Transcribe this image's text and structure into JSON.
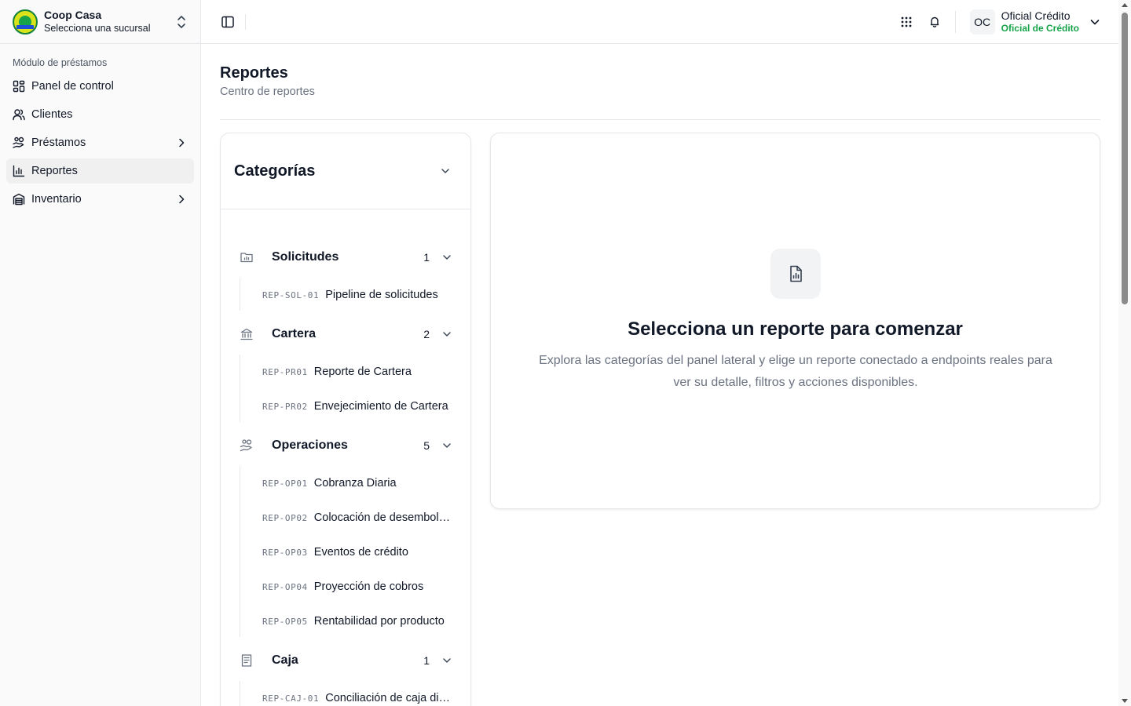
{
  "brand": {
    "name": "Coop Casa",
    "subtitle": "Selecciona una sucursal"
  },
  "sidebar": {
    "group_label": "Módulo de préstamos",
    "items": [
      {
        "label": "Panel de control",
        "icon": "dashboard-icon"
      },
      {
        "label": "Clientes",
        "icon": "users-icon"
      },
      {
        "label": "Préstamos",
        "icon": "hand-coins-icon",
        "has_submenu": true
      },
      {
        "label": "Reportes",
        "icon": "bar-chart-icon",
        "active": true
      },
      {
        "label": "Inventario",
        "icon": "warehouse-icon",
        "has_submenu": true
      }
    ]
  },
  "header": {
    "user": {
      "initials": "OC",
      "name": "Oficial Crédito",
      "role": "Oficial de Crédito"
    }
  },
  "page": {
    "title": "Reportes",
    "subtitle": "Centro de reportes"
  },
  "categories": {
    "title": "Categorías",
    "groups": [
      {
        "name": "Solicitudes",
        "count": "1",
        "icon": "folder-chart-icon",
        "reports": [
          {
            "code": "REP-SOL-01",
            "name": "Pipeline de solicitudes"
          }
        ]
      },
      {
        "name": "Cartera",
        "count": "2",
        "icon": "landmark-icon",
        "reports": [
          {
            "code": "REP-PR01",
            "name": "Reporte de Cartera"
          },
          {
            "code": "REP-PR02",
            "name": "Envejecimiento de Cartera"
          }
        ]
      },
      {
        "name": "Operaciones",
        "count": "5",
        "icon": "hand-coins-icon",
        "reports": [
          {
            "code": "REP-OP01",
            "name": "Cobranza Diaria"
          },
          {
            "code": "REP-OP02",
            "name": "Colocación de desembolsos"
          },
          {
            "code": "REP-OP03",
            "name": "Eventos de crédito"
          },
          {
            "code": "REP-OP04",
            "name": "Proyección de cobros"
          },
          {
            "code": "REP-OP05",
            "name": "Rentabilidad por producto"
          }
        ]
      },
      {
        "name": "Caja",
        "count": "1",
        "icon": "receipt-icon",
        "reports": [
          {
            "code": "REP-CAJ-01",
            "name": "Conciliación de caja diaria"
          }
        ]
      }
    ]
  },
  "empty_state": {
    "title": "Selecciona un reporte para comenzar",
    "description": "Explora las categorías del panel lateral y elige un reporte conectado a endpoints reales para ver su detalle, filtros y acciones disponibles.",
    "icon": "file-chart-icon"
  },
  "colors": {
    "accent_green": "#16a34a",
    "border": "#e5e7eb",
    "muted_text": "#6b7280"
  }
}
